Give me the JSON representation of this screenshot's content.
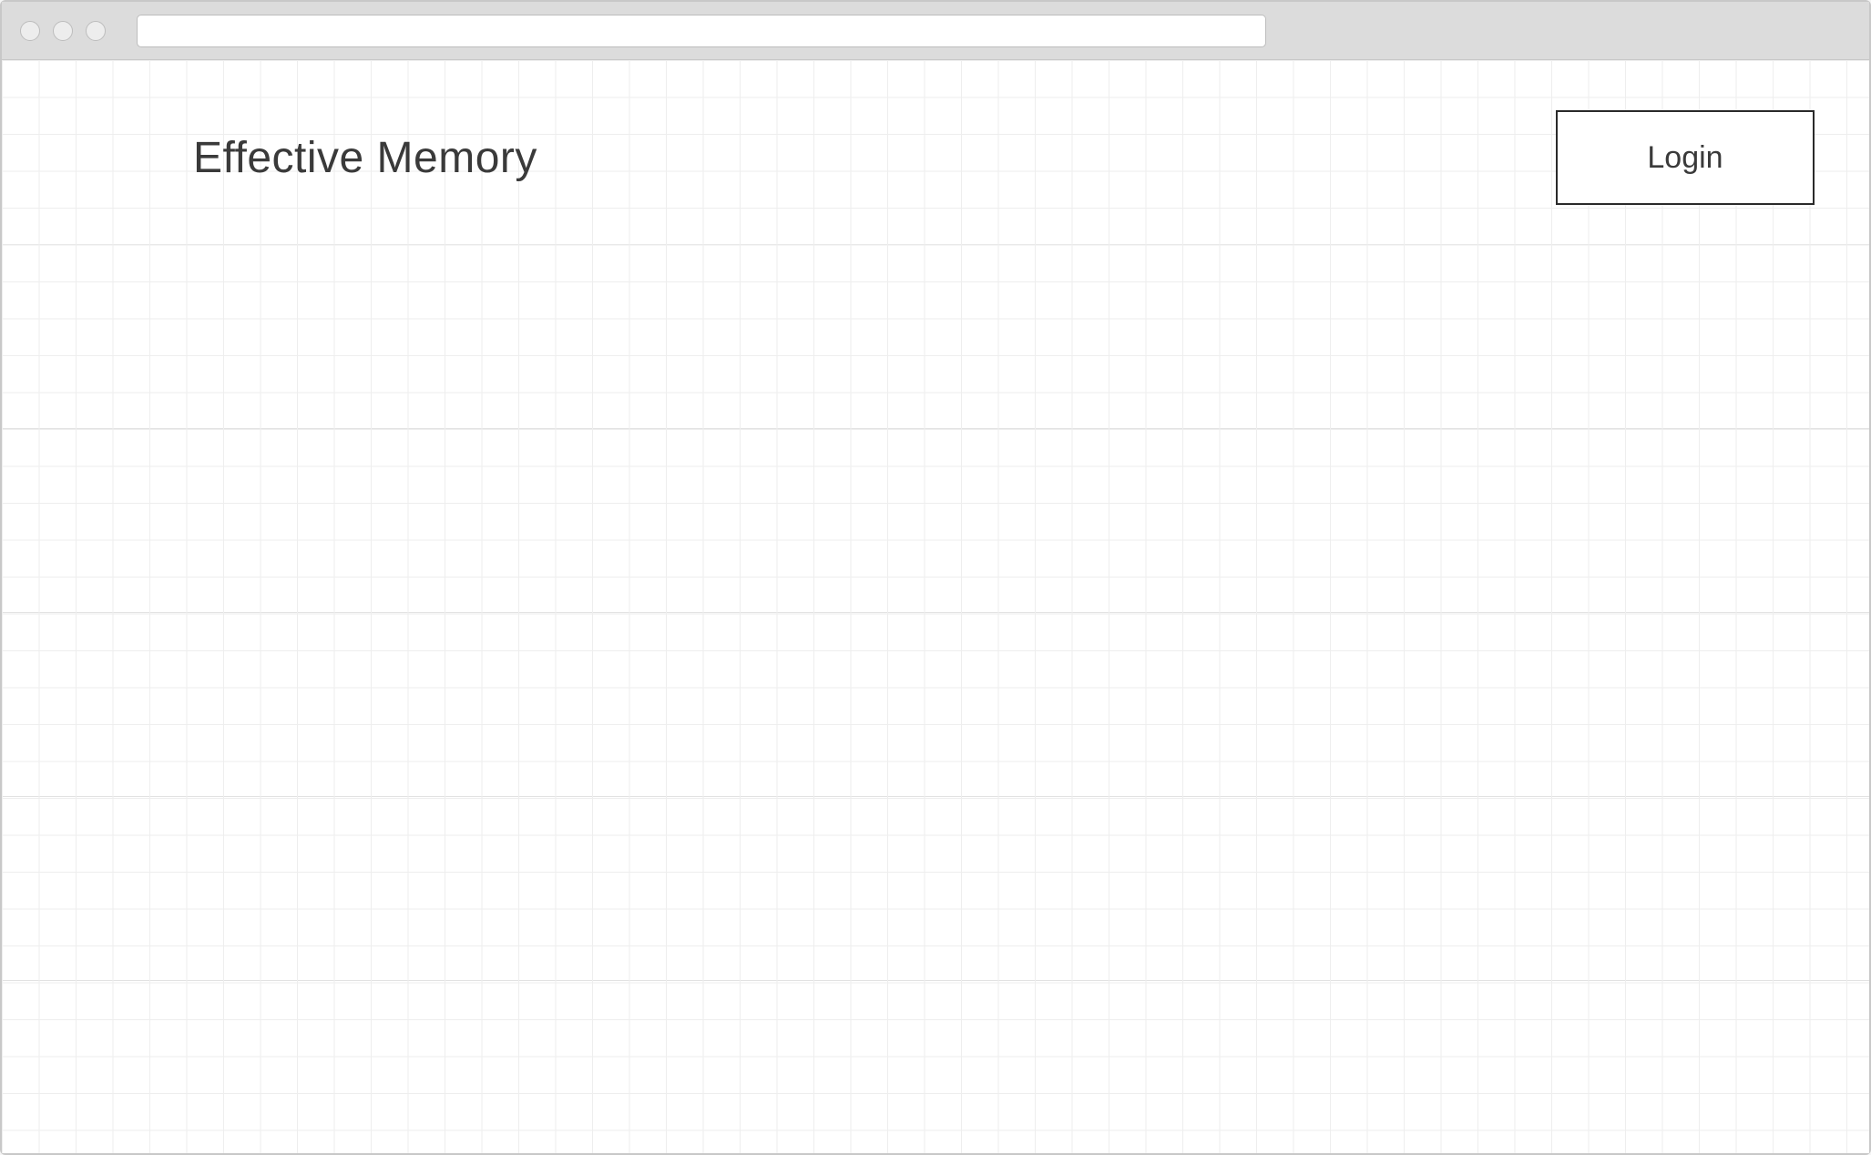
{
  "browser": {
    "address_value": ""
  },
  "header": {
    "title": "Effective Memory",
    "login_label": "Login"
  }
}
